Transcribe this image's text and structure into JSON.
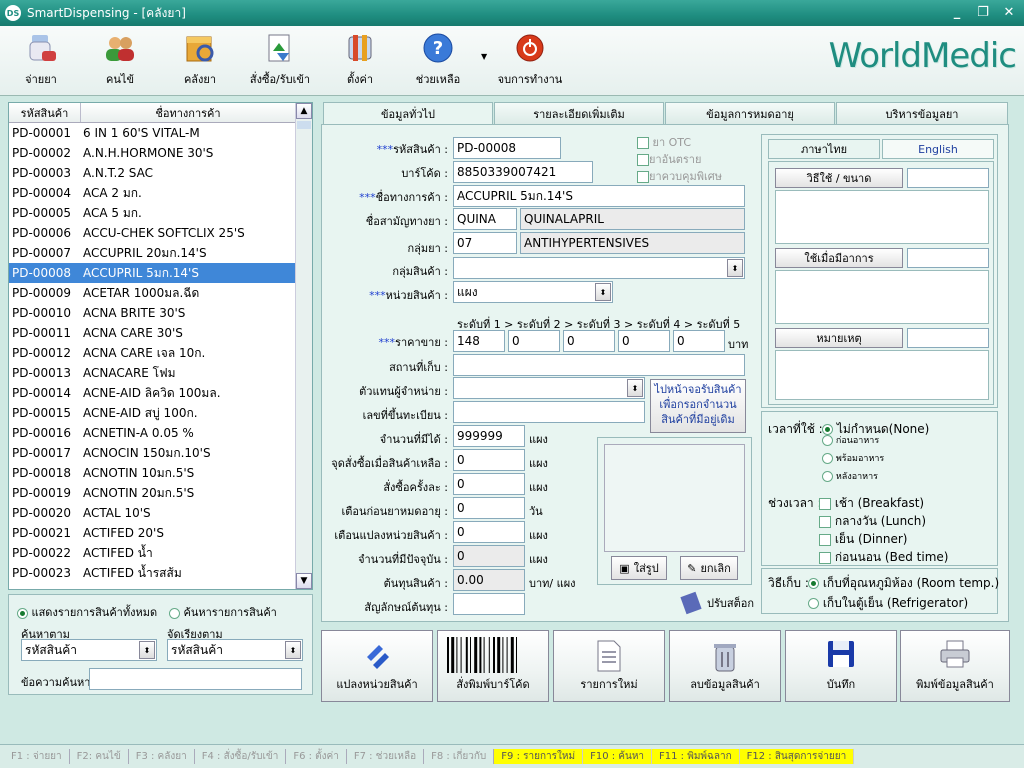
{
  "window": {
    "title": "SmartDispensing - [คลังยา]",
    "icon_text": "DS"
  },
  "toolbar": [
    {
      "label": "จ่ายยา"
    },
    {
      "label": "คนไข้"
    },
    {
      "label": "คลังยา"
    },
    {
      "label": "สั่งซื้อ/รับเข้า"
    },
    {
      "label": "ตั้งค่า"
    },
    {
      "label": "ช่วยเหลือ"
    },
    {
      "label": "จบการทำงาน"
    }
  ],
  "logo": "WorldMedic",
  "list": {
    "col_code": "รหัสสินค้า",
    "col_name": "ชื่อทางการค้า",
    "rows": [
      {
        "code": "PD-00001",
        "name": "6 IN 1 60'S VITAL-M"
      },
      {
        "code": "PD-00002",
        "name": "A.N.H.HORMONE 30'S"
      },
      {
        "code": "PD-00003",
        "name": "A.N.T.2 SAC"
      },
      {
        "code": "PD-00004",
        "name": "ACA 2 มก."
      },
      {
        "code": "PD-00005",
        "name": "ACA 5 มก."
      },
      {
        "code": "PD-00006",
        "name": "ACCU-CHEK SOFTCLIX 25'S"
      },
      {
        "code": "PD-00007",
        "name": "ACCUPRIL 20มก.14'S"
      },
      {
        "code": "PD-00008",
        "name": "ACCUPRIL 5มก.14'S"
      },
      {
        "code": "PD-00009",
        "name": "ACETAR 1000มล.ฉีด"
      },
      {
        "code": "PD-00010",
        "name": "ACNA BRITE 30'S"
      },
      {
        "code": "PD-00011",
        "name": "ACNA CARE 30'S"
      },
      {
        "code": "PD-00012",
        "name": "ACNA CARE เจล 10ก."
      },
      {
        "code": "PD-00013",
        "name": "ACNACARE โฟม"
      },
      {
        "code": "PD-00014",
        "name": "ACNE-AID ลิควิด 100มล."
      },
      {
        "code": "PD-00015",
        "name": "ACNE-AID สบู่ 100ก."
      },
      {
        "code": "PD-00016",
        "name": "ACNETIN-A 0.05 %"
      },
      {
        "code": "PD-00017",
        "name": "ACNOCIN 150มก.10'S"
      },
      {
        "code": "PD-00018",
        "name": "ACNOTIN 10มก.5'S"
      },
      {
        "code": "PD-00019",
        "name": "ACNOTIN 20มก.5'S"
      },
      {
        "code": "PD-00020",
        "name": "ACTAL 10'S"
      },
      {
        "code": "PD-00021",
        "name": "ACTIFED 20'S"
      },
      {
        "code": "PD-00022",
        "name": "ACTIFED น้ำ"
      },
      {
        "code": "PD-00023",
        "name": "ACTIFED น้ำรสส้ม"
      }
    ]
  },
  "filter": {
    "show_all": "แสดงรายการสินค้าทั้งหมด",
    "search_items": "ค้นหารายการสินค้า",
    "search_by_label": "ค้นหาตาม",
    "search_by_value": "รหัสสินค้า",
    "sort_by_label": "จัดเรียงตาม",
    "sort_by_value": "รหัสสินค้า",
    "search_text_label": "ข้อความค้นหา",
    "search_text_value": ""
  },
  "tabs": [
    "ข้อมูลทั่วไป",
    "รายละเอียดเพิ่มเติม",
    "ข้อมูลการหมดอายุ",
    "บริหารข้อมูลยา"
  ],
  "form": {
    "stars": "***",
    "product_code_label": "รหัสสินค้า :",
    "product_code": "PD-00008",
    "barcode_label": "บาร์โค้ด :",
    "barcode": "8850339007421",
    "trade_name_label": "ชื่อทางการค้า :",
    "trade_name": "ACCUPRIL 5มก.14'S",
    "generic_label": "ชื่อสามัญทางยา :",
    "generic_code": "QUINA",
    "generic_name": "QUINALAPRIL",
    "drug_group_label": "กลุ่มยา :",
    "drug_group_code": "07",
    "drug_group_name": "ANTIHYPERTENSIVES",
    "product_group_label": "กลุ่มสินค้า :",
    "product_group": "",
    "unit_label": "หน่วยสินค้า :",
    "unit": "แผง",
    "otc": "ยา OTC",
    "dangerous": "ยาอันตราย",
    "controlled": "ยาควบคุมพิเศษ",
    "levels": "ระดับที่ 1 > ระดับที่ 2 > ระดับที่ 3 > ระดับที่ 4 > ระดับที่ 5",
    "price_label": "ราคาขาย :",
    "prices": [
      "148",
      "0",
      "0",
      "0",
      "0"
    ],
    "baht": "บาท",
    "location_label": "สถานที่เก็บ :",
    "location": "",
    "supplier_label": "ตัวแทนผู้จำหน่าย :",
    "supplier": "",
    "reg_no_label": "เลขที่ขึ้นทะเบียน :",
    "reg_no": "",
    "goto_receive": "ไปหน้าจอรับสินค้า\nเพื่อกรอกจำนวน\nสินค้าที่มีอยู่เดิม",
    "qty_label": "จำนวนที่มีได้ :",
    "qty": "999999",
    "reorder_label": "จุดสั่งซื้อเมื่อสินค้าเหลือ :",
    "reorder": "0",
    "per_order_label": "สั่งซื้อครั้งละ :",
    "per_order": "0",
    "expire_warn_label": "เตือนก่อนยาหมดอายุ :",
    "expire_warn": "0",
    "unit_warn_label": "เตือนแปลงหน่วยสินค้า :",
    "unit_warn": "0",
    "current_label": "จำนวนที่มีปัจจุบัน :",
    "current": "0",
    "cost_label": "ต้นทุนสินค้า :",
    "cost": "0.00",
    "cost_symbol_label": "สัญลักษณ์ต้นทุน :",
    "cost_symbol": "",
    "unit_pack": "แผง",
    "unit_day": "วัน",
    "unit_baht_pack": "บาท/ แผง",
    "insert_image": "ใส่รูป",
    "cancel_image": "ยกเลิก",
    "adjust_stock": "ปรับสต็อก"
  },
  "lang_tabs": [
    "ภาษาไทย",
    "English"
  ],
  "right": {
    "usage": "วิธีใช้ / ขนาด",
    "when_symptom": "ใช้เมื่อมีอาการ",
    "note": "หมายเหตุ"
  },
  "timing": {
    "when_label": "เวลาที่ใช้ :",
    "unspecified": "ไม่กำหนด(None)",
    "before_meal": "ก่อนอาหาร",
    "with_meal": "พร้อมอาหาร",
    "after_meal": "หลังอาหาร",
    "period_label": "ช่วงเวลา :",
    "breakfast": "เช้า (Breakfast)",
    "lunch": "กลางวัน (Lunch)",
    "dinner": "เย็น (Dinner)",
    "bedtime": "ก่อนนอน (Bed time)"
  },
  "storage": {
    "label": "วิธีเก็บ :",
    "room": "เก็บที่อุณหภูมิห้อง (Room temp.)",
    "fridge": "เก็บในตู้เย็น (Refrigerator)"
  },
  "actions": [
    {
      "label": "แปลงหน่วยสินค้า"
    },
    {
      "label": "สั่งพิมพ์บาร์โค้ด"
    },
    {
      "label": "รายการใหม่"
    },
    {
      "label": "ลบข้อมูลสินค้า"
    },
    {
      "label": "บันทึก"
    },
    {
      "label": "พิมพ์ข้อมูลสินค้า"
    }
  ],
  "status": [
    {
      "label": "F1 : จ่ายยา",
      "hl": false
    },
    {
      "label": "F2: คนไข้",
      "hl": false
    },
    {
      "label": "F3 : คลังยา",
      "hl": false
    },
    {
      "label": "F4 : สั่งซื้อ/รับเข้า",
      "hl": false
    },
    {
      "label": "F6 : ตั้งค่า",
      "hl": false
    },
    {
      "label": "F7 : ช่วยเหลือ",
      "hl": false
    },
    {
      "label": "F8 : เกี่ยวกับ",
      "hl": false
    },
    {
      "label": "F9 : รายการใหม่",
      "hl": true
    },
    {
      "label": "F10 : ค้นหา",
      "hl": true
    },
    {
      "label": "F11 : พิมพ์ฉลาก",
      "hl": true
    },
    {
      "label": "F12 : สินสุดการจ่ายยา",
      "hl": true
    }
  ],
  "colors": {
    "accent": "#1f8d80",
    "selection": "#3f87d8",
    "highlight": "#ffff00",
    "required": "#2040d0"
  }
}
